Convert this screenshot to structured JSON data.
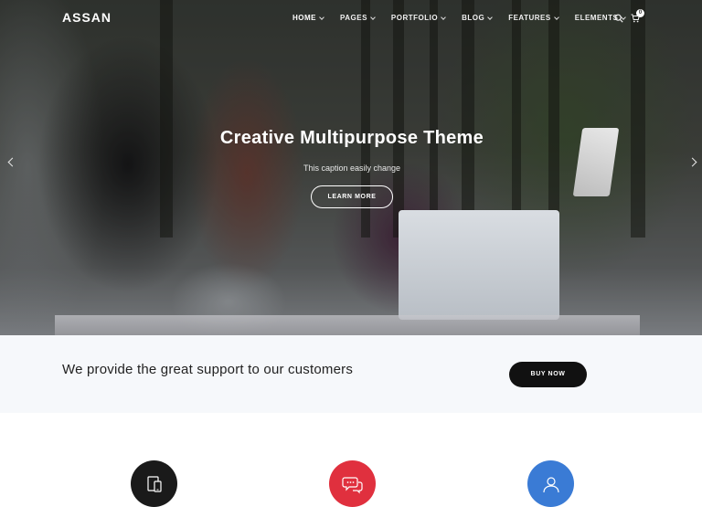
{
  "nav": {
    "brand": "ASSAN",
    "items": [
      {
        "label": "HOME",
        "active": true
      },
      {
        "label": "PAGES",
        "active": false
      },
      {
        "label": "PORTFOLIO",
        "active": false
      },
      {
        "label": "BLOG",
        "active": false
      },
      {
        "label": "FEATURES",
        "active": false
      },
      {
        "label": "ELEMENTS",
        "active": false
      }
    ],
    "cart_count": "0",
    "icons": [
      "search-icon",
      "cart-icon",
      "chevron-down-icon"
    ]
  },
  "hero": {
    "title": "Creative Multipurpose Theme",
    "caption": "This caption easily change",
    "button": "LEARN MORE",
    "icons": [
      "arrow-left-icon",
      "arrow-right-icon"
    ]
  },
  "cta": {
    "text": "We provide the great support to our customers",
    "button": "BUY NOW"
  },
  "features": [
    {
      "icon": "devices-icon",
      "color": "#1a1a1a"
    },
    {
      "icon": "chat-icon",
      "color": "#e0303e"
    },
    {
      "icon": "user-icon",
      "color": "#3a7bd5"
    }
  ]
}
